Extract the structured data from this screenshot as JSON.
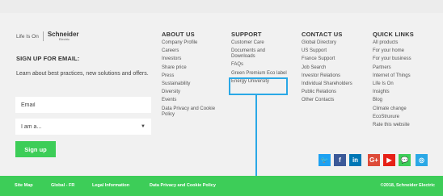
{
  "brand": {
    "tagline": "Life Is On",
    "logo_name": "Schneider",
    "logo_sub": "Electric"
  },
  "signup": {
    "title": "SIGN UP FOR EMAIL:",
    "description": "Learn about best practices, new solutions and offers.",
    "email_placeholder": "Email",
    "select_value": "I am a...",
    "button_label": "Sign up"
  },
  "columns": {
    "about": {
      "title": "ABOUT US",
      "items": [
        "Company Profile",
        "Careers",
        "Investors",
        "Share price",
        "Press",
        "Sustainability",
        "Diversity",
        "Events",
        "Data Privacy and Cookie Policy"
      ]
    },
    "support": {
      "title": "SUPPORT",
      "items": [
        "Customer Care",
        "Documents and Downloads",
        "FAQs",
        "Green Premium Eco label",
        "Energy University"
      ]
    },
    "contact": {
      "title": "CONTACT US",
      "items": [
        "Global Directory",
        "US Support",
        "France Support",
        "Job Search",
        "Investor Relations",
        "Individual Shareholders",
        "Public Relations",
        "Other Contacts"
      ]
    },
    "quick": {
      "title": "QUICK LINKS",
      "items": [
        "All products",
        "For your home",
        "For your business",
        "Partners",
        "Internet of Things",
        "Life Is On",
        "Insights",
        "Blog",
        "Climate change",
        "EcoStruxure",
        "Rate this website"
      ]
    }
  },
  "social": [
    {
      "icon": "twitter-icon",
      "glyph": "🐦",
      "color": "#1da1f2"
    },
    {
      "icon": "facebook-icon",
      "glyph": "f",
      "color": "#3b5998"
    },
    {
      "icon": "linkedin-icon",
      "glyph": "in",
      "color": "#0077b5"
    },
    {
      "icon": "google-plus-icon",
      "glyph": "G+",
      "color": "#dd4b39"
    },
    {
      "icon": "youtube-icon",
      "glyph": "▶",
      "color": "#e62117"
    },
    {
      "icon": "chat-icon",
      "glyph": "💬",
      "color": "#3dcd58"
    },
    {
      "icon": "instagram-icon",
      "glyph": "◎",
      "color": "#2aa8e6"
    }
  ],
  "footer": {
    "links": [
      "Site Map",
      "Global - FR",
      "Legal Information",
      "Data Privacy and Cookie Policy"
    ],
    "copyright": "©2018, Schneider Electric"
  },
  "colors": {
    "accent": "#3dcd58",
    "highlight": "#2aa8e6",
    "background": "#f1f1f1"
  }
}
